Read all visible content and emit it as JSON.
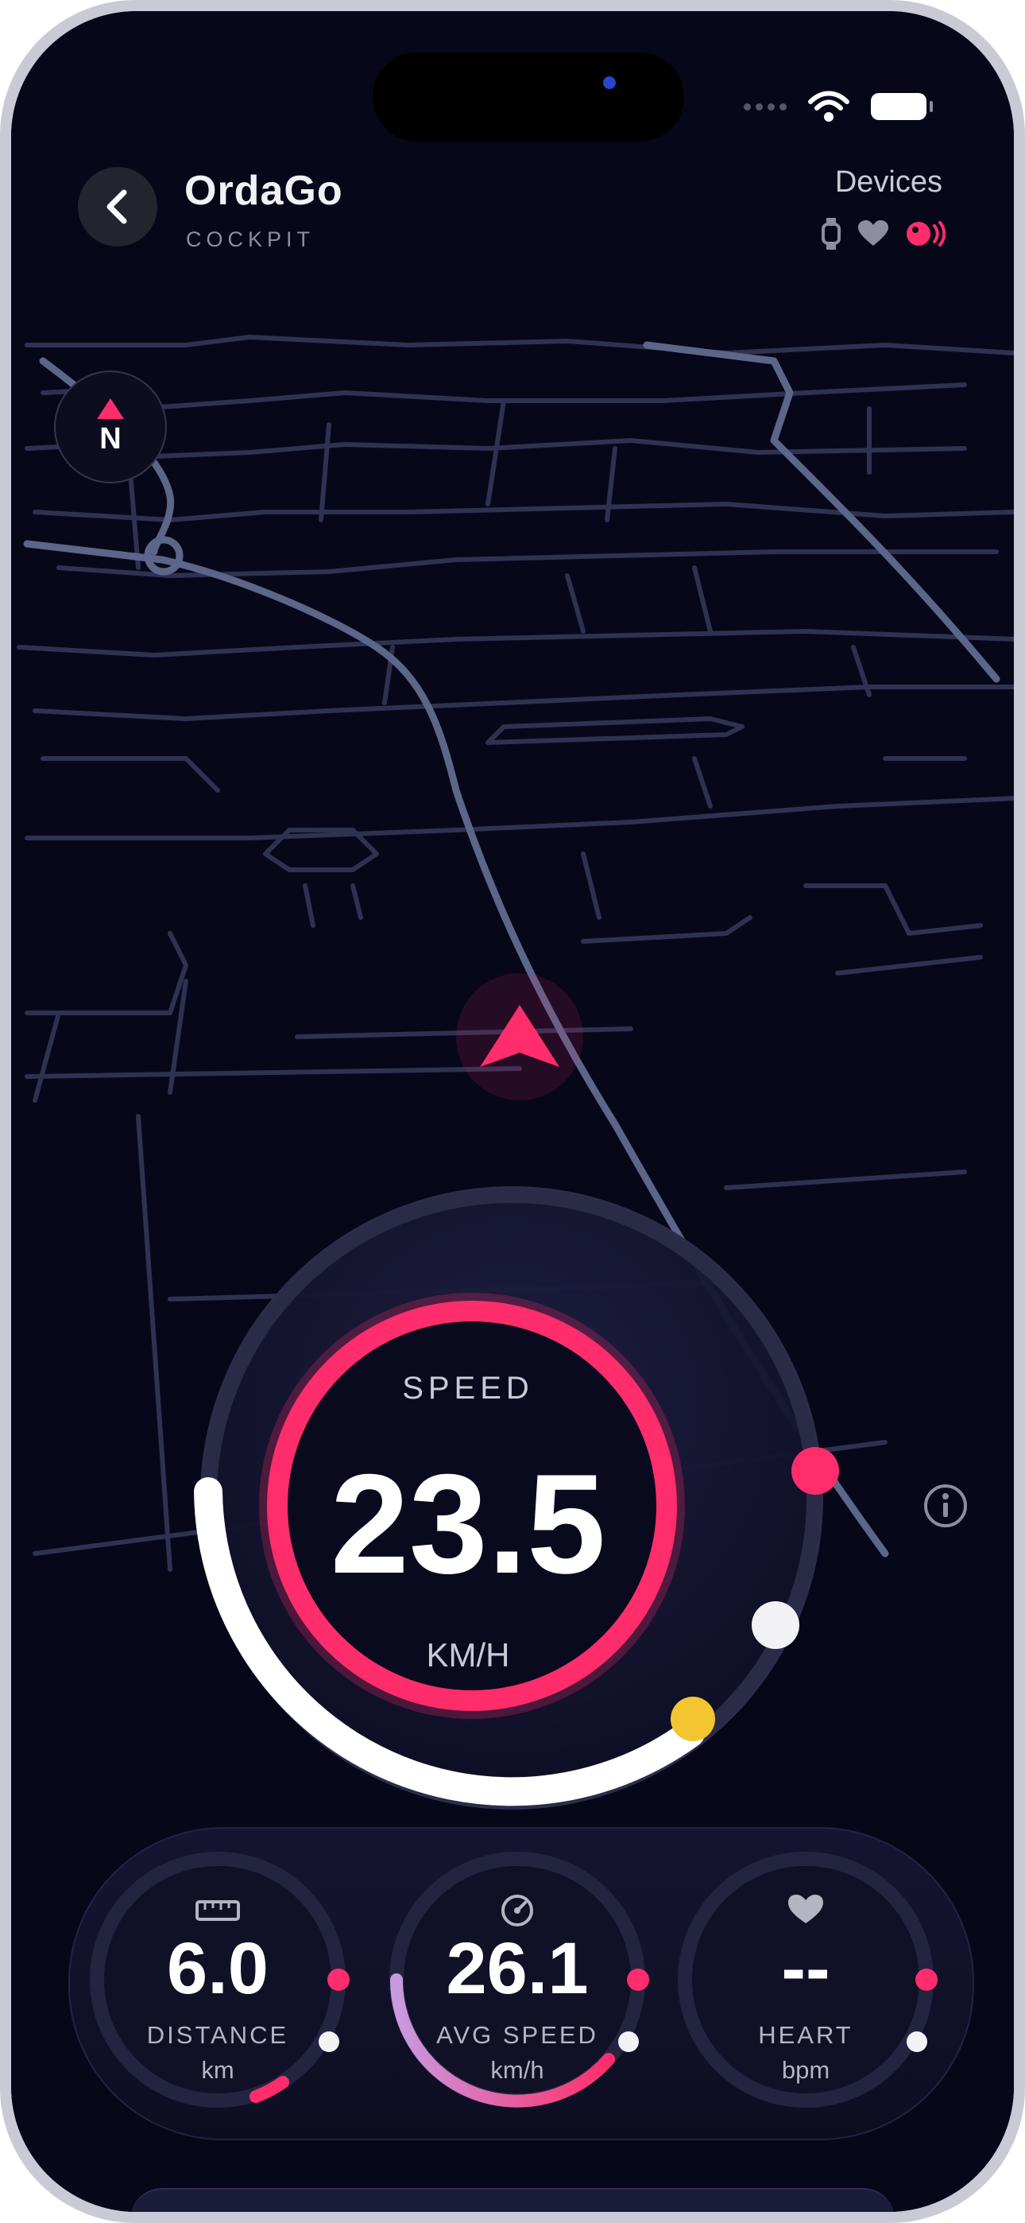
{
  "app": {
    "title": "OrdaGo",
    "subtitle": "COCKPIT"
  },
  "devices": {
    "label": "Devices",
    "icons": [
      "watch-icon",
      "heart-icon",
      "speed-sensor-icon"
    ],
    "active_color": "#ff2d6b"
  },
  "compass": {
    "label": "N"
  },
  "speedometer": {
    "label": "SPEED",
    "value": "23.5",
    "unit": "KM/H"
  },
  "stats": [
    {
      "value": "6.0",
      "label": "DISTANCE",
      "unit": "km",
      "icon": "ruler-icon"
    },
    {
      "value": "26.1",
      "label": "AVG SPEED",
      "unit": "km/h",
      "icon": "speedometer-icon"
    },
    {
      "value": "--",
      "label": "HEART",
      "unit": "bpm",
      "icon": "heart-icon"
    }
  ],
  "colors": {
    "accent": "#ff2d6b",
    "highlight": "#f2c531",
    "background": "#07071a",
    "map_road": "#5c6688"
  }
}
